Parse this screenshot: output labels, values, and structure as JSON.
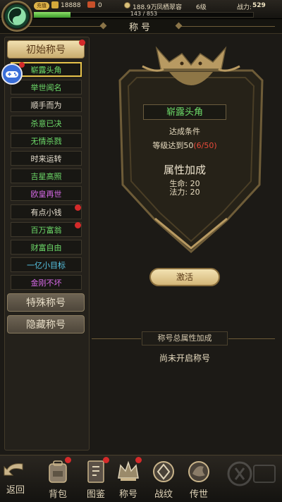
{
  "topbar": {
    "vip_label": "充值",
    "gold": "18888",
    "coupon_count": "0",
    "coin": "188.9万",
    "player_name": "凤栖翠容",
    "level": "6级",
    "power_label": "战力:",
    "power_value": "529",
    "exp_text": "143 / 853",
    "exp_progress": 0.168
  },
  "header": {
    "title": "称号"
  },
  "categories": {
    "initial": "初始称号",
    "special": "特殊称号",
    "hidden": "隐藏称号"
  },
  "titles": [
    {
      "label": "崭露头角",
      "color": "#6edc6a",
      "selected": true,
      "dot": false
    },
    {
      "label": "举世闻名",
      "color": "#6edc6a",
      "selected": false,
      "dot": false
    },
    {
      "label": "顺手而为",
      "color": "#e8e0d0",
      "selected": false,
      "dot": false
    },
    {
      "label": "杀意已决",
      "color": "#6edc6a",
      "selected": false,
      "dot": false
    },
    {
      "label": "无情杀戮",
      "color": "#6edc6a",
      "selected": false,
      "dot": false
    },
    {
      "label": "时来运转",
      "color": "#e8e0d0",
      "selected": false,
      "dot": false
    },
    {
      "label": "吉星高照",
      "color": "#6edc6a",
      "selected": false,
      "dot": false
    },
    {
      "label": "欧皇再世",
      "color": "#d86ae8",
      "selected": false,
      "dot": false
    },
    {
      "label": "有点小钱",
      "color": "#e8e0d0",
      "selected": false,
      "dot": true
    },
    {
      "label": "百万富翁",
      "color": "#6edc6a",
      "selected": false,
      "dot": true
    },
    {
      "label": "财富自由",
      "color": "#6edc6a",
      "selected": false,
      "dot": false
    },
    {
      "label": "一亿小目标",
      "color": "#58c8e8",
      "selected": false,
      "dot": false
    },
    {
      "label": "金刚不坏",
      "color": "#d86ae8",
      "selected": false,
      "dot": false
    }
  ],
  "detail": {
    "name": "崭露头角",
    "condition_label": "达成条件",
    "condition_text": "等级达到50",
    "condition_progress": "(6/50)",
    "attr_title": "属性加成",
    "attr_hp": "生命: 20",
    "attr_mp": "法力: 20",
    "activate_label": "激活",
    "total_attr_label": "称号总属性加成",
    "total_attr_status": "尚未开启称号"
  },
  "bottom_nav": {
    "back": "返回",
    "items": [
      {
        "label": "背包",
        "icon": "backpack-icon",
        "dot": true
      },
      {
        "label": "图鉴",
        "icon": "book-icon",
        "dot": true
      },
      {
        "label": "称号",
        "icon": "crown-icon",
        "dot": true
      },
      {
        "label": "战纹",
        "icon": "emblem-icon",
        "dot": false
      },
      {
        "label": "传世",
        "icon": "dragon-icon",
        "dot": false
      }
    ]
  },
  "colors": {
    "accent_gold": "#c9ac6e",
    "green_text": "#6edc6a",
    "red_progress": "#e84a3a",
    "notification": "#d42a2a"
  }
}
